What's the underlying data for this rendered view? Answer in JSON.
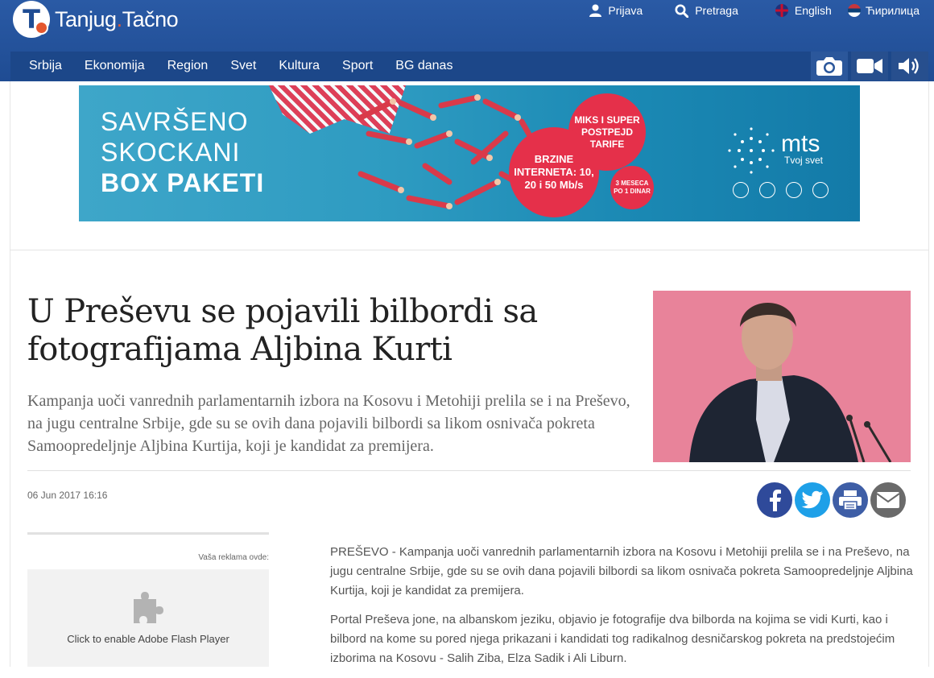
{
  "brand": {
    "name": "Tanjug",
    "dot": ".",
    "suffix": "Tačno"
  },
  "top_links": {
    "login": "Prijava",
    "search": "Pretraga",
    "english": "English",
    "cyrillic": "Ћирилица"
  },
  "nav": {
    "items": [
      "Srbija",
      "Ekonomija",
      "Region",
      "Svet",
      "Kultura",
      "Sport",
      "BG danas"
    ],
    "media": [
      "camera-icon",
      "video-icon",
      "audio-icon"
    ]
  },
  "banner": {
    "line1": "SAVRŠENO",
    "line2": "SKOCKANI",
    "line3": "BOX PAKETI",
    "badge_mid": "MIKS I SUPER POSTPEJD TARIFE",
    "badge_big": "BRZINE INTERNETA: 10, 20 i 50 Mb/s",
    "badge_small": "3 MESECA PO 1 DINAR",
    "brand": "mts",
    "tagline": "Tvoj svet"
  },
  "article": {
    "title": "U Preševu se pojavili bilbordi sa fotografijama Aljbina Kurti",
    "lead": "Kampanja uoči vanrednih parlamentarnih izbora na Kosovu i Metohiji prelila se i na Preševo, na jugu centralne Srbije, gde su se ovih dana pojavili bilbordi sa likom osnivača pokreta Samoopredeljnje Aljbina Kurtija, koji je kandidat za premijera.",
    "date": "06 Jun 2017 16:16",
    "paragraphs": [
      "PREŠEVO - Kampanja uoči vanrednih parlamentarnih izbora na Kosovu i Metohiji prelila se i na Preševo, na jugu centralne Srbije, gde su se ovih dana pojavili bilbordi sa likom osnivača pokreta Samoopredeljnje Aljbina Kurtija, koji je kandidat za premijera.",
      "Portal Preševa jone, na albanskom jeziku, objavio je fotografije dva bilborda na kojima se vidi Kurti, kao i bilbord na kome su pored njega prikazani i kandidati tog radikalnog desničarskog pokreta na predstojećim izborima na Kosovu - Salih Ziba, Elza Sadik i Ali Liburn."
    ]
  },
  "share": [
    "facebook-icon",
    "twitter-icon",
    "print-icon",
    "email-icon"
  ],
  "ad": {
    "label": "Vaša reklama ovde:",
    "flash_text": "Click to enable Adobe Flash Player"
  },
  "colors": {
    "header_bg": "#1f4c93",
    "nav_bg": "#1c4789",
    "accent_red": "#e5304a",
    "facebook": "#2f4a9a",
    "twitter": "#1ea0e8"
  }
}
